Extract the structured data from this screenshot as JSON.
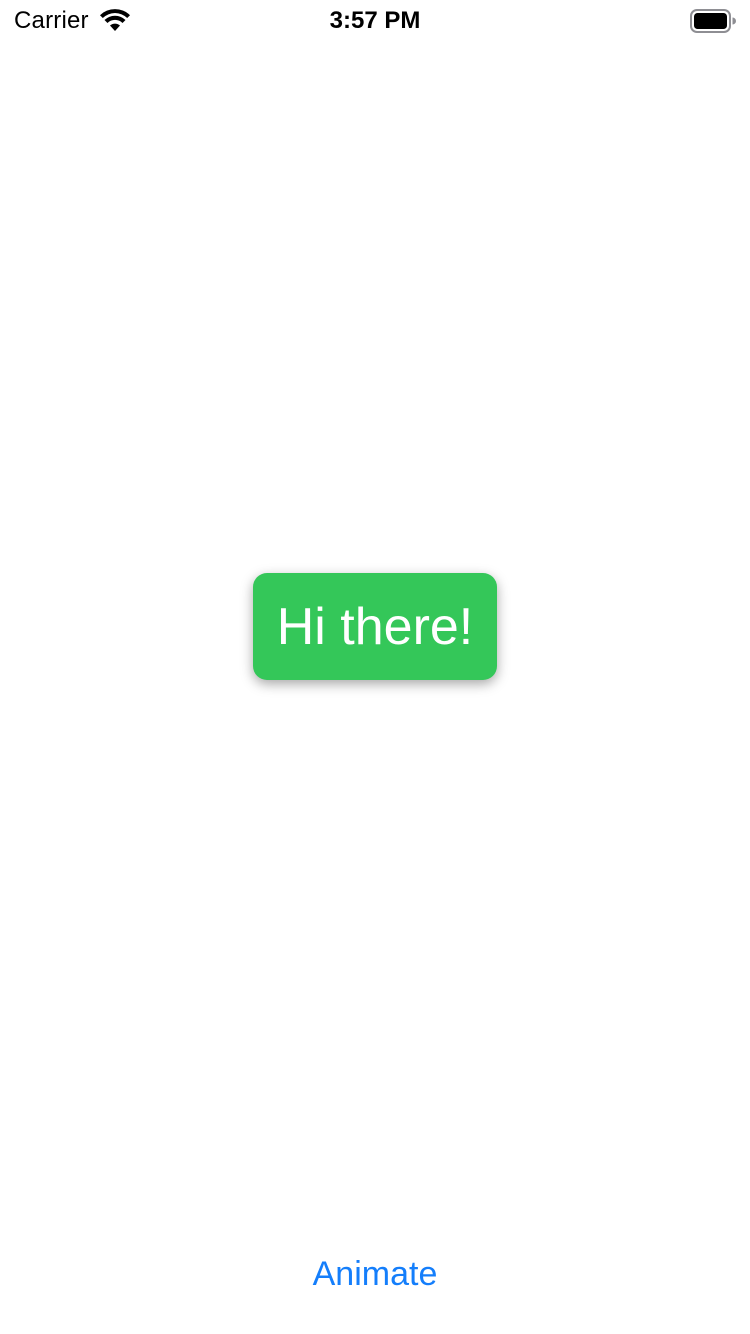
{
  "status_bar": {
    "carrier": "Carrier",
    "time": "3:57 PM",
    "wifi_icon": "wifi-icon",
    "battery_icon": "battery-icon"
  },
  "bubble": {
    "text": "Hi there!",
    "color": "#34c759"
  },
  "animate_button": {
    "label": "Animate",
    "color": "#147efb"
  }
}
